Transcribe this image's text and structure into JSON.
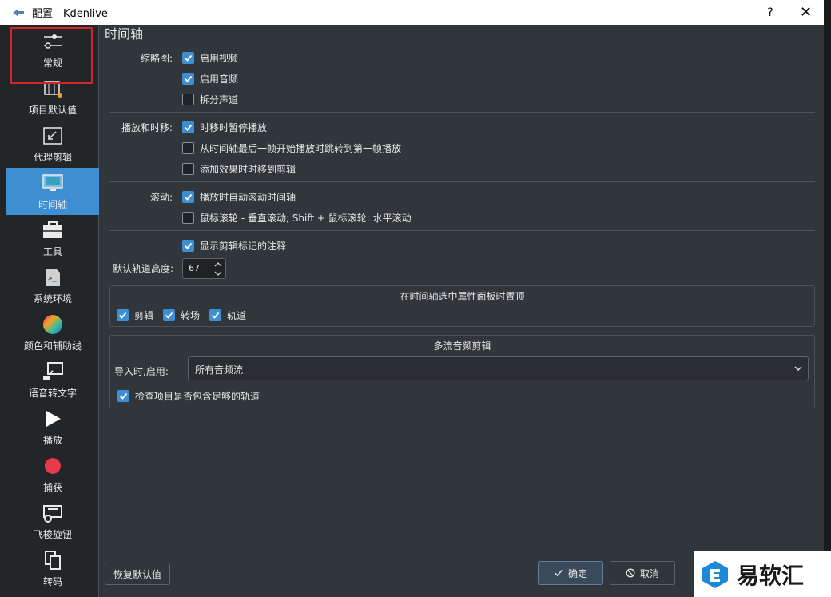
{
  "window": {
    "title": "配置 - Kdenlive",
    "help": "?",
    "close": "✕"
  },
  "sidebar": {
    "items": [
      {
        "label": "常规",
        "icon": "sliders-icon",
        "active": false
      },
      {
        "label": "项目默认值",
        "icon": "project-defaults-icon",
        "active": false
      },
      {
        "label": "代理剪辑",
        "icon": "proxy-icon",
        "active": false
      },
      {
        "label": "时间轴",
        "icon": "timeline-monitor-icon",
        "active": true
      },
      {
        "label": "工具",
        "icon": "toolbox-icon",
        "active": false
      },
      {
        "label": "系统环境",
        "icon": "terminal-icon",
        "active": false
      },
      {
        "label": "颜色和辅助线",
        "icon": "color-wheel-icon",
        "active": false
      },
      {
        "label": "语音转文字",
        "icon": "speech-icon",
        "active": false
      },
      {
        "label": "播放",
        "icon": "play-icon",
        "active": false
      },
      {
        "label": "捕获",
        "icon": "record-icon",
        "active": false
      },
      {
        "label": "飞梭旋钮",
        "icon": "jog-shuttle-icon",
        "active": false
      },
      {
        "label": "转码",
        "icon": "transcode-icon",
        "active": false
      }
    ]
  },
  "page": {
    "title": "时间轴",
    "thumbnails": {
      "label": "缩略图:",
      "video": {
        "label": "启用视频",
        "checked": true
      },
      "audio": {
        "label": "启用音频",
        "checked": true
      },
      "split": {
        "label": "拆分声道",
        "checked": false
      }
    },
    "playback": {
      "label": "播放和时移:",
      "pause_on_seek": {
        "label": "时移时暂停播放",
        "checked": true
      },
      "jump_first": {
        "label": "从时间轴最后一帧开始播放时跳转到第一帧播放",
        "checked": false
      },
      "seek_on_effect": {
        "label": "添加效果时时移到剪辑",
        "checked": false
      }
    },
    "scrolling": {
      "label": "滚动:",
      "autoscroll": {
        "label": "播放时自动滚动时间轴",
        "checked": true
      },
      "wheel": {
        "label": "鼠标滚轮 - 垂直滚动; Shift + 鼠标滚轮: 水平滚动",
        "checked": false
      }
    },
    "show_markers": {
      "label": "显示剪辑标记的注释",
      "checked": true
    },
    "track_height": {
      "label": "默认轨道高度:",
      "value": "67"
    },
    "properties_group": {
      "title": "在时间轴选中属性面板时置顶",
      "clips": {
        "label": "剪辑",
        "checked": true
      },
      "transitions": {
        "label": "转场",
        "checked": true
      },
      "tracks": {
        "label": "轨道",
        "checked": true
      }
    },
    "multistream_group": {
      "title": "多流音频剪辑",
      "import_label": "导入时,启用:",
      "import_value": "所有音频流",
      "check_tracks": {
        "label": "检查项目是否包含足够的轨道",
        "checked": true
      }
    }
  },
  "buttons": {
    "restore": "恢复默认值",
    "ok": "确定",
    "cancel": "取消"
  },
  "watermark": {
    "text": "易软汇"
  },
  "colors": {
    "accent": "#3d8fd1",
    "highlight": "#d8232a"
  }
}
